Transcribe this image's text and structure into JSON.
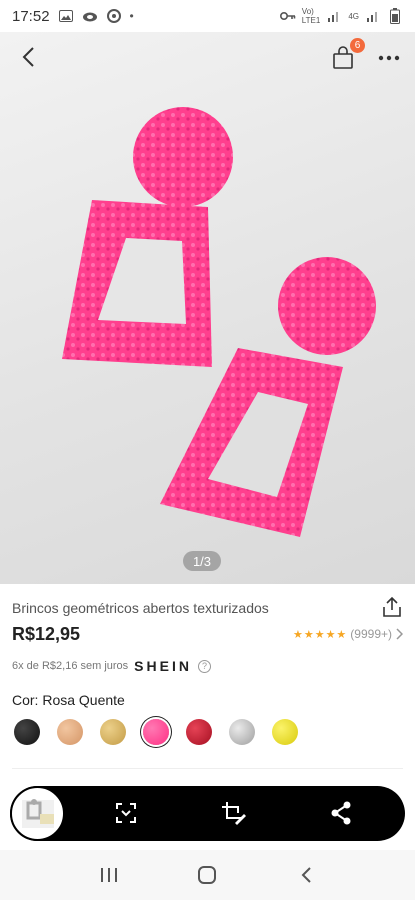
{
  "status_bar": {
    "time": "17:52",
    "dot": "•",
    "network_top": "Vo)",
    "network_bottom": "LTE1",
    "net_type": "4G"
  },
  "hero": {
    "pager": "1/3",
    "cart_count": "6"
  },
  "product": {
    "title": "Brincos geométricos abertos texturizados",
    "price": "R$12,95",
    "rating_stars": "★★★★★",
    "rating_count": "(9999+)",
    "installment": "6x de R$2,16 sem juros",
    "brand": "SHEIN",
    "help": "?",
    "color_label": "Cor: Rosa Quente"
  },
  "swatch_colors": [
    "#1a1a1a",
    "#e0a477",
    "#d6b062",
    "#ff3f8e",
    "#c11a2c",
    "#bdbdbd",
    "#e8de1a"
  ],
  "colors": {
    "accent_pink": "#ff3f8e",
    "badge_orange": "#f36a3c",
    "star_gold": "#f6a623"
  }
}
